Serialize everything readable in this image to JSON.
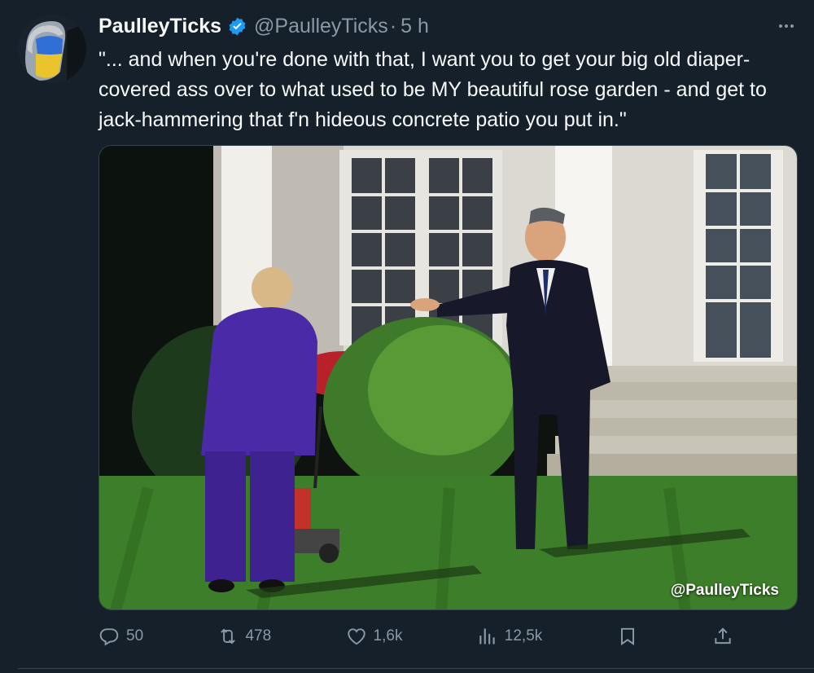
{
  "author": {
    "display_name": "PaulleyTicks",
    "handle": "@PaulleyTicks",
    "separator": "·",
    "time_ago": "5 h",
    "verified": true
  },
  "tweet": {
    "text": "\"... and when you're done with that, I want you to get your big old diaper-covered ass over to what used to be MY beautiful rose garden - and get to jack-hammering that f'n hideous concrete patio you put in.\""
  },
  "media": {
    "watermark": "@PaulleyTicks"
  },
  "actions": {
    "replies": "50",
    "retweets": "478",
    "likes": "1,6k",
    "views": "12,5k"
  },
  "colors": {
    "background": "#15202b",
    "text": "#f7f9f9",
    "muted": "#8b98a5",
    "verified_badge": "#1d9bf0"
  },
  "icons": [
    "more-icon",
    "verified-badge-icon",
    "reply-icon",
    "retweet-icon",
    "like-icon",
    "views-icon",
    "bookmark-icon",
    "share-icon"
  ]
}
